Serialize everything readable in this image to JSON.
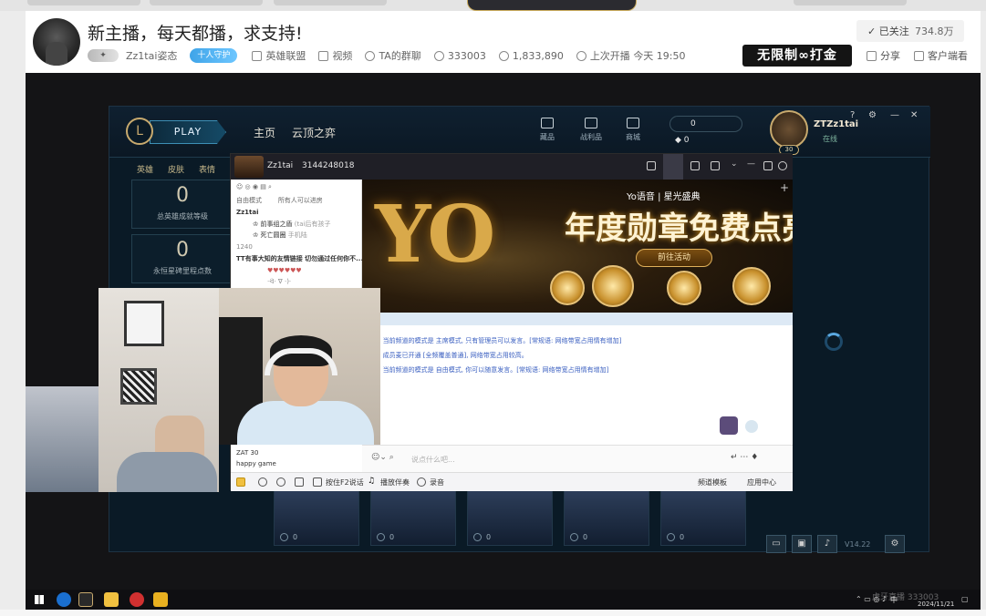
{
  "header": {
    "room_title": "新主播，每天都播，求支持!",
    "streamer_name": "Zz1tai姿态",
    "guard_label": "十人守护",
    "category": "英雄联盟",
    "video_label": "视频",
    "fan_group_label": "TA的群聊",
    "room_id": "333003",
    "heat": "1,833,890",
    "last_live_label": "上次开播",
    "last_live_time": "今天 19:50",
    "follow_label": "已关注",
    "follower_count": "734.8万",
    "promo_text": "无限制∞打金",
    "share_label": "分享",
    "client_watch_label": "客户端看"
  },
  "lol_client": {
    "play_label": "PLAY",
    "nav_home": "主页",
    "nav_tft": "云顶之弈",
    "icon_collection": "藏品",
    "icon_loot": "战利品",
    "icon_store": "商城",
    "currency_rp": "0",
    "currency_be": "0",
    "player_name": "ZTZz1tai",
    "player_status": "在线",
    "player_level": "30",
    "side_tabs": [
      "英雄",
      "皮肤",
      "表情"
    ],
    "stat_mastery_value": "0",
    "stat_mastery_label": "总英雄成就等级",
    "stat_eternal_value": "0",
    "stat_eternal_label": "永恒星碑里程点数",
    "champ_costs": [
      "0",
      "0",
      "0",
      "0",
      "0"
    ],
    "version": "V14.22"
  },
  "chat_app": {
    "room_name": "Zz1tai",
    "room_number": "31442480",
    "online_count": "18",
    "side_mode": "自由模式",
    "side_all_enter": "所有人可以进房",
    "side_owner": "Zz1tai",
    "side_user1": "前事组之盾",
    "side_user1_tag": "(tai后有孩子",
    "side_user2": "死亡圆圈",
    "side_user2_tag": "手机陆",
    "side_count_line": "1240",
    "side_notice": "TT有事大知的友情链接 切勿通过任何你不...",
    "side_emote": "·ᐛ· ∇ ·)·",
    "side_footer1": "ZAT 30",
    "side_footer2": "happy game",
    "banner_brand": "Yo语音",
    "banner_brand2": "星光盛典",
    "banner_headline": "年度勋章免费点亮",
    "banner_cta": "前往活动",
    "sys_msg_1": "通知: 当前频道的模式是 主席模式, 只有管理员可以发言。[常规语: 网络带宽占用情有增加]",
    "sys_msg_2": "通知: 成员麦已开通 [全频覆盖普通], 网络带宽占用较高。",
    "sys_msg_3": "通知: 当前频道的模式是 自由模式, 你可以随意发言。[常规语: 网络带宽占用情有增加]",
    "input_placeholder": "说点什么吧...",
    "toolbar_items": [
      "按住F2说话",
      "播放伴奏",
      "录音"
    ],
    "toolbar_right_1": "频道模板",
    "toolbar_right_2": "应用中心"
  },
  "taskbar": {
    "ime": "中",
    "date": "2024/11/21",
    "watermark": "虎牙直播 333003"
  },
  "colors": {
    "lol_gold": "#c8aa6e",
    "lol_bg": "#0a1a26",
    "yo_gold": "#d9a94a",
    "guard_blue": "#3fa4e8"
  }
}
